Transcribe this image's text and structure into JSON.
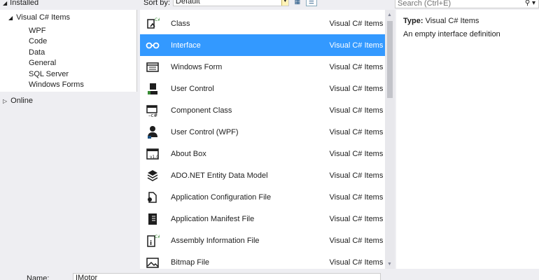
{
  "header": {
    "installed_label": "Installed",
    "sort_by_label": "Sort by:",
    "sort_value": "Default",
    "search_placeholder": "Search (Ctrl+E)"
  },
  "tree": {
    "root_label": "Visual C# Items",
    "children": [
      "WPF",
      "Code",
      "Data",
      "General",
      "SQL Server",
      "Windows Forms"
    ],
    "online_label": "Online"
  },
  "items": [
    {
      "name": "Class",
      "category": "Visual C# Items",
      "icon": "class-icon"
    },
    {
      "name": "Interface",
      "category": "Visual C# Items",
      "icon": "interface-icon",
      "selected": true
    },
    {
      "name": "Windows Form",
      "category": "Visual C# Items",
      "icon": "windows-form-icon"
    },
    {
      "name": "User Control",
      "category": "Visual C# Items",
      "icon": "user-control-icon"
    },
    {
      "name": "Component Class",
      "category": "Visual C# Items",
      "icon": "component-class-icon"
    },
    {
      "name": "User Control (WPF)",
      "category": "Visual C# Items",
      "icon": "user-control-wpf-icon"
    },
    {
      "name": "About Box",
      "category": "Visual C# Items",
      "icon": "about-box-icon"
    },
    {
      "name": "ADO.NET Entity Data Model",
      "category": "Visual C# Items",
      "icon": "entity-data-model-icon"
    },
    {
      "name": "Application Configuration File",
      "category": "Visual C# Items",
      "icon": "config-file-icon"
    },
    {
      "name": "Application Manifest File",
      "category": "Visual C# Items",
      "icon": "manifest-file-icon"
    },
    {
      "name": "Assembly Information File",
      "category": "Visual C# Items",
      "icon": "assembly-info-icon"
    },
    {
      "name": "Bitmap File",
      "category": "Visual C# Items",
      "icon": "bitmap-file-icon"
    }
  ],
  "details": {
    "type_label": "Type:",
    "type_value": "Visual C# Items",
    "description": "An empty interface definition"
  },
  "footer": {
    "name_label": "Name:",
    "name_value": "IMotor"
  },
  "colors": {
    "selection": "#3399ff",
    "icon": "#1e1e1e",
    "accent_green": "#388a34"
  }
}
